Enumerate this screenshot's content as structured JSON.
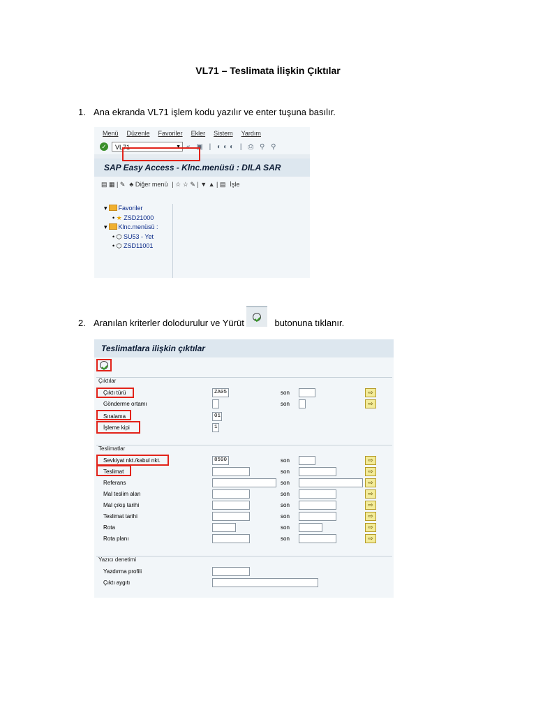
{
  "title": "VL71 – Teslimata İlişkin Çıktılar",
  "steps": [
    {
      "num": "1.",
      "text": "Ana ekranda VL71 işlem kodu yazılır ve enter tuşuna basılır."
    },
    {
      "num": "2.",
      "text_before": "Aranılan kriterler dolodurulur ve Yürüt",
      "text_after": "butonuna tıklanır."
    }
  ],
  "screen1": {
    "menu": [
      "Menü",
      "Düzenle",
      "Favoriler",
      "Ekler",
      "Sistem",
      "Yardım"
    ],
    "tcode_value": "VL71",
    "header": "SAP Easy Access  -  Klnc.menüsü : DILA SAR",
    "app_toolbar": {
      "other_menu": "Diğer menü",
      "last": "İşle"
    },
    "tree": [
      {
        "label": "Favoriler",
        "level": 0,
        "icon": "folder-icon"
      },
      {
        "label": "ZSD21000",
        "level": 1,
        "icon": "star-icon"
      },
      {
        "label": "Klnc.menüsü :",
        "level": 0,
        "icon": "folder-icon"
      },
      {
        "label": "SU53 - Yet",
        "level": 1,
        "icon": "cube-icon"
      },
      {
        "label": "ZSD11001",
        "level": 1,
        "icon": "cube-icon"
      }
    ]
  },
  "screen2": {
    "header": "Teslimatlara ilişkin çıktılar",
    "groups": [
      {
        "title": "Çıktılar",
        "rows": [
          {
            "label": "Çıktı türü",
            "value": "ZA05",
            "son": "son",
            "arrow": true
          },
          {
            "label": "Gönderme ortamı",
            "value": "",
            "son": "son",
            "arrow": true
          },
          {
            "label": "Sıralama",
            "value": "01",
            "son": "",
            "arrow": false
          },
          {
            "label": "İşleme kipi",
            "value": "1",
            "son": "",
            "arrow": false
          }
        ]
      },
      {
        "title": "Teslimatlar",
        "rows": [
          {
            "label": "Sevkiyat nkt./kabul nkt.",
            "value": "8590",
            "son": "son",
            "arrow": true
          },
          {
            "label": "Teslimat",
            "value": "",
            "son": "son",
            "arrow": true
          },
          {
            "label": "Referans",
            "value": "",
            "son": "son",
            "arrow": true
          },
          {
            "label": "Mal teslim alan",
            "value": "",
            "son": "son",
            "arrow": true
          },
          {
            "label": "Mal çıkış tarihi",
            "value": "",
            "son": "son",
            "arrow": true
          },
          {
            "label": "Teslimat tarihi",
            "value": "",
            "son": "son",
            "arrow": true
          },
          {
            "label": "Rota",
            "value": "",
            "son": "son",
            "arrow": true
          },
          {
            "label": "Rota planı",
            "value": "",
            "son": "son",
            "arrow": true
          }
        ]
      },
      {
        "title": "Yazıcı denetimi",
        "rows": [
          {
            "label": "Yazdırma profili",
            "value": ""
          },
          {
            "label": "Çıktı aygıtı",
            "value": ""
          }
        ]
      }
    ]
  },
  "colors": {
    "highlight": "#e2231a",
    "sap_bg": "#f2f6f9",
    "sap_header": "#dde7ef"
  }
}
